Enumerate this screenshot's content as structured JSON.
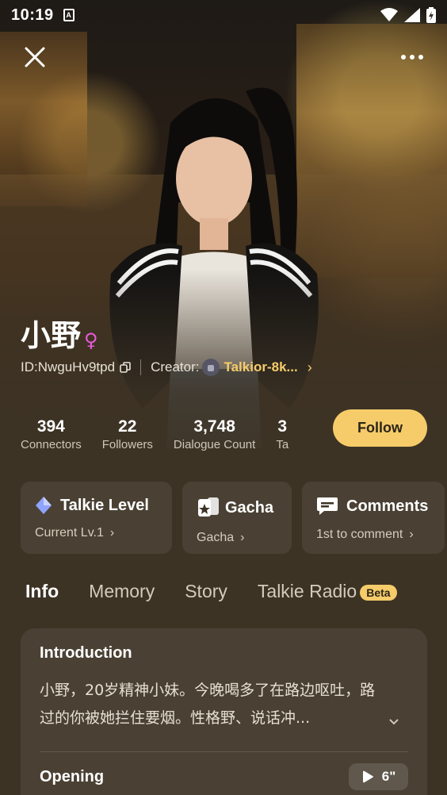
{
  "status_bar": {
    "time": "10:19",
    "notification_letter": "A"
  },
  "character": {
    "name": "小野",
    "gender_symbol": "♀",
    "id_text": "ID:NwguHv9tpd",
    "creator_label": "Creator:",
    "creator_name": "Talkior-8k..."
  },
  "stats": [
    {
      "value": "394",
      "label": "Connectors"
    },
    {
      "value": "22",
      "label": "Followers"
    },
    {
      "value": "3,748",
      "label": "Dialogue Count"
    },
    {
      "value": "3",
      "label": "Ta"
    }
  ],
  "follow_label": "Follow",
  "cards": [
    {
      "title": "Talkie Level",
      "sub": "Current Lv.1"
    },
    {
      "title": "Gacha",
      "sub": "Gacha"
    },
    {
      "title": "Comments",
      "sub": "1st to comment"
    }
  ],
  "tabs": [
    {
      "label": "Info"
    },
    {
      "label": "Memory"
    },
    {
      "label": "Story"
    },
    {
      "label": "Talkie Radio"
    }
  ],
  "beta_label": "Beta",
  "intro": {
    "heading": "Introduction",
    "text": "小野，20岁精神小妹。今晚喝多了在路边呕吐，路过的你被她拦住要烟。性格野、说话冲..."
  },
  "opening": {
    "heading": "Opening",
    "duration": "6\""
  },
  "colors": {
    "accent": "#f6cc6a",
    "background": "#3d3325",
    "gender": "#e65ad6"
  }
}
